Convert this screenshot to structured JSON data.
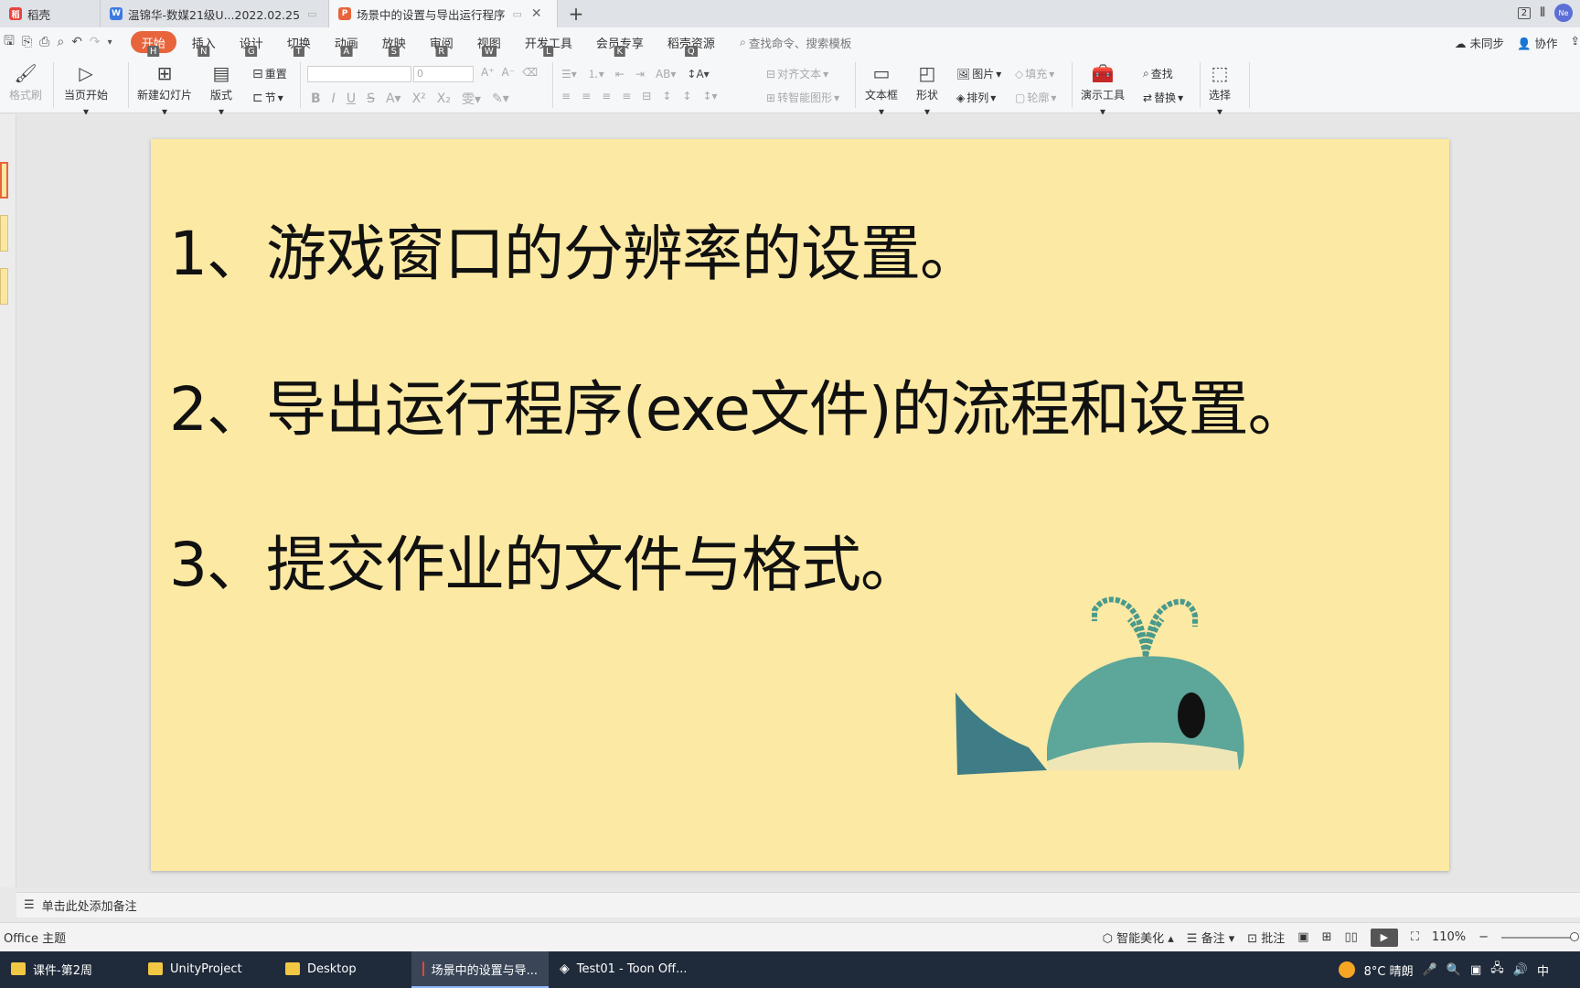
{
  "tabs": [
    {
      "label": "稻壳",
      "icon": "docer-icon",
      "color": "#e8443c"
    },
    {
      "label": "温锦华-数媒21级U...2022.02.25",
      "icon": "word-doc-icon",
      "color": "#3b7ae0"
    },
    {
      "label": "场景中的设置与导出运行程序",
      "icon": "ppt-doc-icon",
      "color": "#e8643c"
    }
  ],
  "tabbar_right": {
    "window_count": "2",
    "avatar_text": "Ne"
  },
  "menus": [
    {
      "label": "开始",
      "key": "H"
    },
    {
      "label": "插入",
      "key": "N"
    },
    {
      "label": "设计",
      "key": "G"
    },
    {
      "label": "切换",
      "key": "T"
    },
    {
      "label": "动画",
      "key": "A"
    },
    {
      "label": "放映",
      "key": "S"
    },
    {
      "label": "审阅",
      "key": "R"
    },
    {
      "label": "视图",
      "key": "W"
    },
    {
      "label": "开发工具",
      "key": "L"
    },
    {
      "label": "会员专享",
      "key": "K"
    },
    {
      "label": "稻壳资源",
      "key": "Q"
    }
  ],
  "search_cmd": "查找命令、搜索模板",
  "menu_right": {
    "sync": "未同步",
    "collab": "协作"
  },
  "ribbon": {
    "format_brush": "格式刷",
    "start_from_current": "当页开始",
    "new_slide": "新建幻灯片",
    "layout": "版式",
    "reset": "重置",
    "section": "节",
    "font_size": "0",
    "align_text": "对齐文本",
    "convert_smartart": "转智能图形",
    "textbox": "文本框",
    "shape": "形状",
    "picture": "图片",
    "arrange": "排列",
    "fill": "填充",
    "outline": "轮廓",
    "present_tools": "演示工具",
    "find": "查找",
    "replace": "替换",
    "select": "选择"
  },
  "slide": {
    "lines": [
      "1、游戏窗口的分辨率的设置。",
      "2、导出运行程序(exe文件)的流程和设置。",
      "3、提交作业的文件与格式。"
    ],
    "background": "#fce9a3"
  },
  "notes_placeholder": "单击此处添加备注",
  "status": {
    "theme": "Office 主题",
    "beautify": "智能美化",
    "notes": "备注",
    "comments": "批注",
    "zoom": "110%"
  },
  "taskbar": {
    "items": [
      {
        "label": "课件-第2周",
        "icon": "folder-icon"
      },
      {
        "label": "UnityProject",
        "icon": "folder-icon"
      },
      {
        "label": "Desktop",
        "icon": "folder-icon"
      },
      {
        "label": "场景中的设置与导...",
        "icon": "wps-icon"
      },
      {
        "label": "Test01 - Toon Off...",
        "icon": "unity-icon"
      }
    ],
    "weather": "8°C  晴朗",
    "ime": "中"
  }
}
